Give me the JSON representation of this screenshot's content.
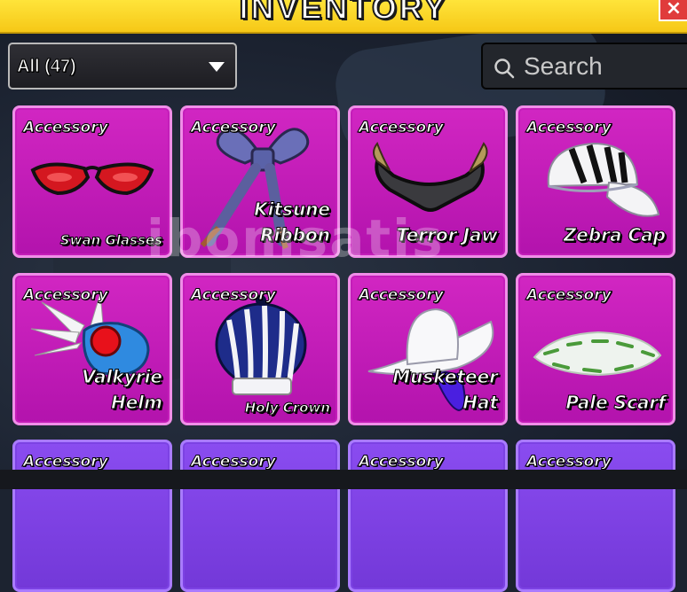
{
  "header": {
    "title": "INVENTORY",
    "close_label": "×"
  },
  "filter": {
    "selected": "All (47)"
  },
  "search": {
    "placeholder": "Search"
  },
  "items": [
    {
      "category": "Accessory",
      "name": "Swan Glasses",
      "icon": "swan-glasses-icon"
    },
    {
      "category": "Accessory",
      "name": "Kitsune Ribbon",
      "icon": "kitsune-ribbon-icon"
    },
    {
      "category": "Accessory",
      "name": "Terror Jaw",
      "icon": "terror-jaw-icon"
    },
    {
      "category": "Accessory",
      "name": "Zebra Cap",
      "icon": "zebra-cap-icon"
    },
    {
      "category": "Accessory",
      "name": "Valkyrie Helm",
      "icon": "valkyrie-helm-icon"
    },
    {
      "category": "Accessory",
      "name": "Holy Crown",
      "icon": "holy-crown-icon"
    },
    {
      "category": "Accessory",
      "name": "Musketeer Hat",
      "icon": "musketeer-hat-icon"
    },
    {
      "category": "Accessory",
      "name": "Pale Scarf",
      "icon": "pale-scarf-icon"
    },
    {
      "category": "Accessory",
      "name": "",
      "icon": ""
    },
    {
      "category": "Accessory",
      "name": "",
      "icon": ""
    },
    {
      "category": "Accessory",
      "name": "",
      "icon": ""
    },
    {
      "category": "Accessory",
      "name": "",
      "icon": ""
    }
  ],
  "colors": {
    "header": "#f6c817",
    "card_magenta": "#c41db9",
    "card_purple": "#7c42e3",
    "close": "#e03b3b"
  },
  "watermark": "ibomsatis"
}
